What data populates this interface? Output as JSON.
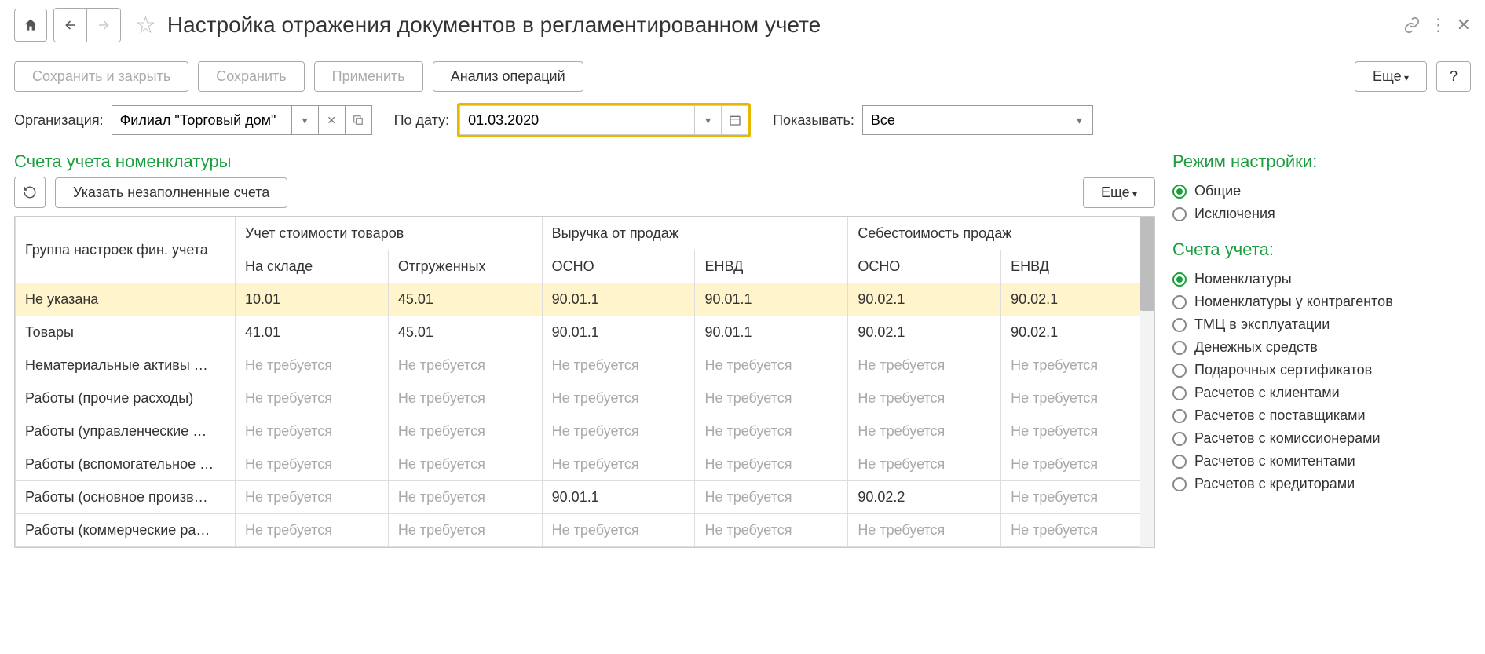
{
  "header": {
    "title": "Настройка отражения документов в регламентированном учете"
  },
  "toolbar": {
    "save_close": "Сохранить и закрыть",
    "save": "Сохранить",
    "apply": "Применить",
    "analyze": "Анализ операций",
    "more": "Еще",
    "help": "?"
  },
  "filters": {
    "org_label": "Организация:",
    "org_value": "Филиал \"Торговый дом\"",
    "date_label": "По дату:",
    "date_value": "01.03.2020",
    "show_label": "Показывать:",
    "show_value": "Все"
  },
  "section_accounts_title": "Счета учета номенклатуры",
  "subtoolbar": {
    "fill_empty": "Указать незаполненные счета",
    "more": "Еще"
  },
  "table": {
    "headers_row1": {
      "c0": "Группа настроек фин. учета",
      "c1": "Учет стоимости товаров",
      "c2": "Выручка от продаж",
      "c3": "Себестоимость продаж"
    },
    "headers_row2": {
      "c1a": "На складе",
      "c1b": "Отгруженных",
      "c2a": "ОСНО",
      "c2b": "ЕНВД",
      "c3a": "ОСНО",
      "c3b": "ЕНВД"
    },
    "rows": [
      {
        "name": "Не указана",
        "c1a": "10.01",
        "c1b": "45.01",
        "c2a": "90.01.1",
        "c2b": "90.01.1",
        "c3a": "90.02.1",
        "c3b": "90.02.1",
        "dim": [],
        "hl": true
      },
      {
        "name": "Товары",
        "c1a": "41.01",
        "c1b": "45.01",
        "c2a": "90.01.1",
        "c2b": "90.01.1",
        "c3a": "90.02.1",
        "c3b": "90.02.1",
        "dim": []
      },
      {
        "name": "Нематериальные активы …",
        "c1a": "Не требуется",
        "c1b": "Не требуется",
        "c2a": "Не требуется",
        "c2b": "Не требуется",
        "c3a": "Не требуется",
        "c3b": "Не требуется",
        "dim": [
          "c1a",
          "c1b",
          "c2a",
          "c2b",
          "c3a",
          "c3b"
        ]
      },
      {
        "name": "Работы (прочие расходы)",
        "c1a": "Не требуется",
        "c1b": "Не требуется",
        "c2a": "Не требуется",
        "c2b": "Не требуется",
        "c3a": "Не требуется",
        "c3b": "Не требуется",
        "dim": [
          "c1a",
          "c1b",
          "c2a",
          "c2b",
          "c3a",
          "c3b"
        ]
      },
      {
        "name": "Работы (управленческие …",
        "c1a": "Не требуется",
        "c1b": "Не требуется",
        "c2a": "Не требуется",
        "c2b": "Не требуется",
        "c3a": "Не требуется",
        "c3b": "Не требуется",
        "dim": [
          "c1a",
          "c1b",
          "c2a",
          "c2b",
          "c3a",
          "c3b"
        ]
      },
      {
        "name": "Работы (вспомогательное …",
        "c1a": "Не требуется",
        "c1b": "Не требуется",
        "c2a": "Не требуется",
        "c2b": "Не требуется",
        "c3a": "Не требуется",
        "c3b": "Не требуется",
        "dim": [
          "c1a",
          "c1b",
          "c2a",
          "c2b",
          "c3a",
          "c3b"
        ]
      },
      {
        "name": "Работы (основное произв…",
        "c1a": "Не требуется",
        "c1b": "Не требуется",
        "c2a": "90.01.1",
        "c2b": "Не требуется",
        "c3a": "90.02.2",
        "c3b": "Не требуется",
        "dim": [
          "c1a",
          "c1b",
          "c2b",
          "c3b"
        ]
      },
      {
        "name": "Работы (коммерческие ра…",
        "c1a": "Не требуется",
        "c1b": "Не требуется",
        "c2a": "Не требуется",
        "c2b": "Не требуется",
        "c3a": "Не требуется",
        "c3b": "Не требуется",
        "dim": [
          "c1a",
          "c1b",
          "c2a",
          "c2b",
          "c3a",
          "c3b"
        ]
      }
    ]
  },
  "right": {
    "mode_title": "Режим настройки:",
    "mode_options": [
      {
        "label": "Общие",
        "checked": true
      },
      {
        "label": "Исключения",
        "checked": false
      }
    ],
    "accounts_title": "Счета учета:",
    "accounts_options": [
      {
        "label": "Номенклатуры",
        "checked": true
      },
      {
        "label": "Номенклатуры у контрагентов",
        "checked": false
      },
      {
        "label": "ТМЦ в эксплуатации",
        "checked": false
      },
      {
        "label": "Денежных средств",
        "checked": false
      },
      {
        "label": "Подарочных сертификатов",
        "checked": false
      },
      {
        "label": "Расчетов с клиентами",
        "checked": false
      },
      {
        "label": "Расчетов с поставщиками",
        "checked": false
      },
      {
        "label": "Расчетов с комиссионерами",
        "checked": false
      },
      {
        "label": "Расчетов с комитентами",
        "checked": false
      },
      {
        "label": "Расчетов с кредиторами",
        "checked": false
      }
    ]
  }
}
